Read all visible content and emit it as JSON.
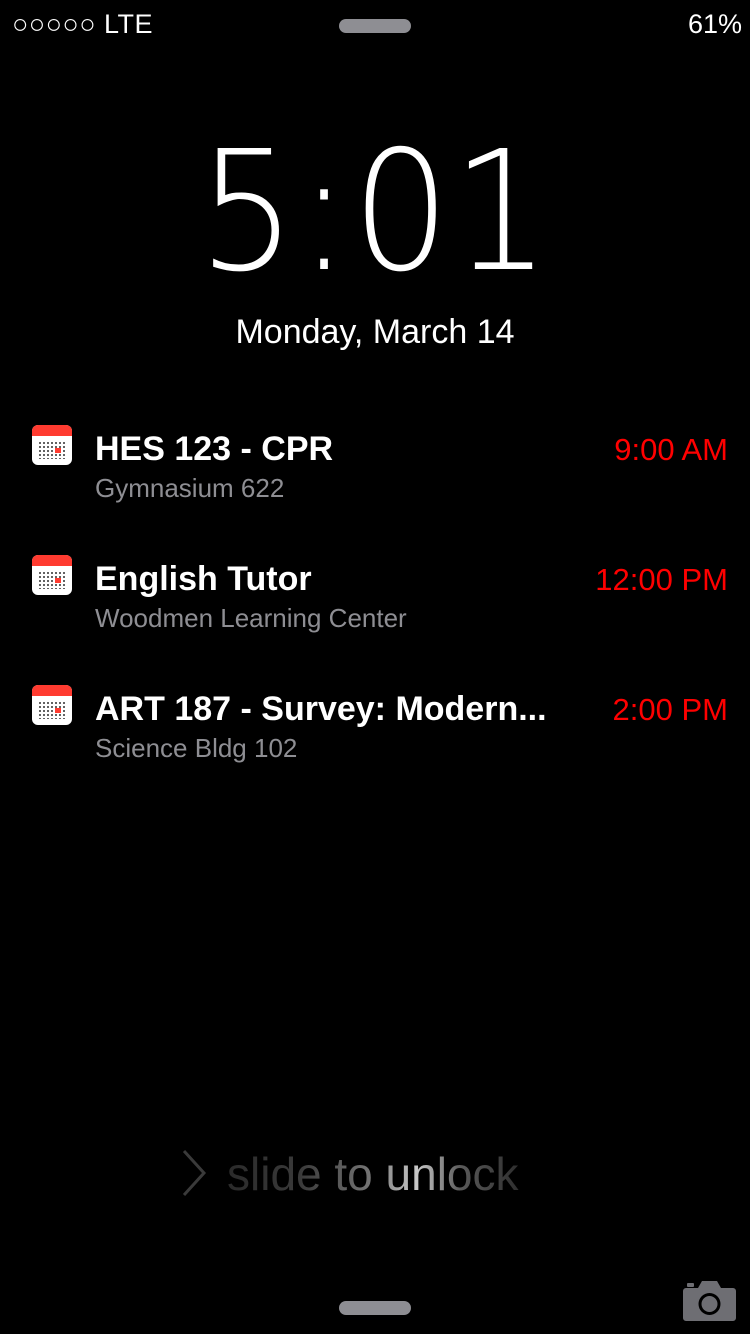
{
  "status_bar": {
    "signal": "○○○○○ LTE",
    "battery": "61%"
  },
  "lock_screen": {
    "time": "5:01",
    "date": "Monday, March 14"
  },
  "events": [
    {
      "title": "HES 123 - CPR",
      "location": "Gymnasium 622",
      "time": "9:00 AM",
      "icon": "calendar-icon"
    },
    {
      "title": "English Tutor",
      "location": "Woodmen Learning Center",
      "time": "12:00 PM",
      "icon": "calendar-icon"
    },
    {
      "title": "ART 187 - Survey: Modern...",
      "location": "Science Bldg 102",
      "time": "2:00 PM",
      "icon": "calendar-icon"
    }
  ],
  "unlock": {
    "label": "slide to unlock"
  },
  "colors": {
    "background": "#000000",
    "event_time": "#ff0000",
    "location_text": "#8e8e93",
    "calendar_accent": "#ff3b30"
  }
}
